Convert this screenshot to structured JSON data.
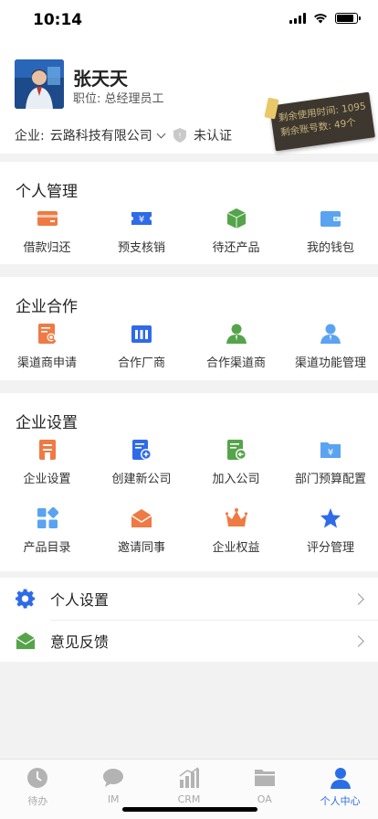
{
  "status": {
    "time": "10:14"
  },
  "profile": {
    "name": "张天天",
    "position": "职位: 总经理员工",
    "company_prefix": "企业:",
    "company": "云路科技有限公司",
    "cert_status": "未认证"
  },
  "license": {
    "line1": "剩余使用时间: 1095",
    "line2": "剩余账号数: 49个"
  },
  "personal": {
    "title": "个人管理",
    "items": [
      {
        "label": "借款归还",
        "icon": "card-icon",
        "color": "#ef7a43"
      },
      {
        "label": "预支核销",
        "icon": "ticket-icon",
        "color": "#2f6be8"
      },
      {
        "label": "待还产品",
        "icon": "box-icon",
        "color": "#55a44a"
      },
      {
        "label": "我的钱包",
        "icon": "wallet-icon",
        "color": "#5aa3f0"
      }
    ]
  },
  "cooperation": {
    "title": "企业合作",
    "items": [
      {
        "label": "渠道商申请",
        "icon": "document-search-icon",
        "color": "#ef7a43"
      },
      {
        "label": "合作厂商",
        "icon": "factory-icon",
        "color": "#2f6be8"
      },
      {
        "label": "合作渠道商",
        "icon": "user-icon",
        "color": "#55a44a"
      },
      {
        "label": "渠道功能管理",
        "icon": "user-manage-icon",
        "color": "#5aa3f0"
      }
    ]
  },
  "settings": {
    "title": "企业设置",
    "items": [
      {
        "label": "企业设置",
        "icon": "building-icon",
        "color": "#ef7a43"
      },
      {
        "label": "创建新公司",
        "icon": "add-document-icon",
        "color": "#2f6be8"
      },
      {
        "label": "加入公司",
        "icon": "join-document-icon",
        "color": "#55a44a"
      },
      {
        "label": "部门预算配置",
        "icon": "budget-folder-icon",
        "color": "#5aa3f0"
      },
      {
        "label": "产品目录",
        "icon": "catalog-grid-icon",
        "color": "#5aa3f0"
      },
      {
        "label": "邀请同事",
        "icon": "envelope-icon",
        "color": "#ef7a43"
      },
      {
        "label": "企业权益",
        "icon": "crown-icon",
        "color": "#ef7a43"
      },
      {
        "label": "评分管理",
        "icon": "star-icon",
        "color": "#2f6be8"
      }
    ]
  },
  "list": {
    "items": [
      {
        "label": "个人设置",
        "icon": "gear-icon"
      },
      {
        "label": "意见反馈",
        "icon": "feedback-envelope-icon"
      }
    ]
  },
  "tabbar": {
    "items": [
      {
        "label": "待办",
        "icon": "clock-icon",
        "active": false
      },
      {
        "label": "IM",
        "icon": "chat-icon",
        "active": false
      },
      {
        "label": "CRM",
        "icon": "chart-icon",
        "active": false
      },
      {
        "label": "OA",
        "icon": "folder-icon",
        "active": false
      },
      {
        "label": "个人中心",
        "icon": "person-icon",
        "active": true
      }
    ]
  }
}
